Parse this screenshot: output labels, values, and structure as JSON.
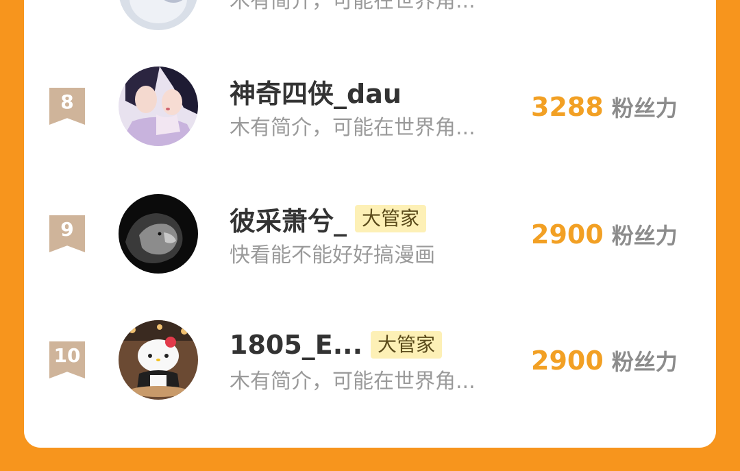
{
  "partial_row": {
    "desc": "木有简介，可能在世界角..."
  },
  "rows": [
    {
      "rank": "8",
      "name": "神奇四侠_dau",
      "badge": "",
      "desc": "木有简介，可能在世界角...",
      "score": "3288",
      "unit": "粉丝力",
      "avatar_icon": "anime-couple-avatar"
    },
    {
      "rank": "9",
      "name": "彼采萧兮_",
      "badge": "大管家",
      "desc": "快看能不能好好搞漫画",
      "score": "2900",
      "unit": "粉丝力",
      "avatar_icon": "lion-avatar"
    },
    {
      "rank": "10",
      "name": "1805_E...",
      "badge": "大管家",
      "desc": "木有简介，可能在世界角...",
      "score": "2900",
      "unit": "粉丝力",
      "avatar_icon": "hello-kitty-avatar"
    }
  ],
  "colors": {
    "background": "#f7951d",
    "card": "#ffffff",
    "score": "#f2a024",
    "rank_ribbon": "#cfb49a",
    "badge_bg": "#fdf0b6"
  }
}
